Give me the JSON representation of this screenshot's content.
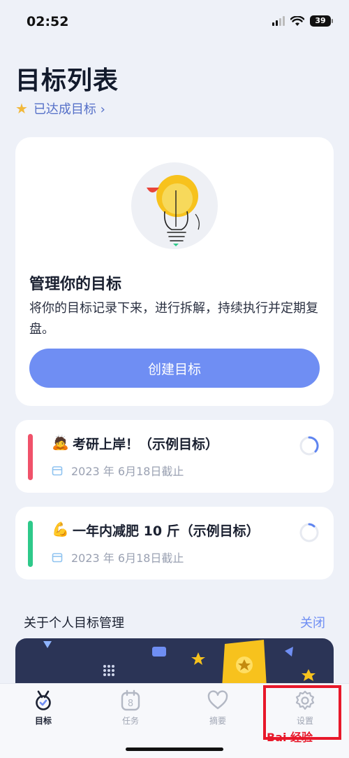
{
  "status": {
    "time": "02:52",
    "battery": "39"
  },
  "header": {
    "title": "目标列表",
    "achieved_link": "已达成目标 ›"
  },
  "hero": {
    "title": "管理你的目标",
    "description": "将你的目标记录下来，进行拆解，持续执行并定期复盘。",
    "create_button": "创建目标"
  },
  "goals": [
    {
      "emoji": "🙇",
      "title": "考研上岸！（示例目标）",
      "deadline": "2023 年 6月18日截止",
      "color": "#f0526a"
    },
    {
      "emoji": "💪",
      "title": "一年内减肥 10 斤（示例目标）",
      "deadline": "2023 年 6月18日截止",
      "color": "#2ec98a"
    }
  ],
  "about": {
    "title": "关于个人目标管理",
    "close_label": "关闭"
  },
  "tabs": [
    {
      "label": "目标",
      "icon": "medal-icon",
      "active": true
    },
    {
      "label": "任务",
      "icon": "calendar-8-icon",
      "active": false
    },
    {
      "label": "摘要",
      "icon": "heart-icon",
      "active": false
    },
    {
      "label": "设置",
      "icon": "gear-icon",
      "active": false
    }
  ],
  "watermark": "Bai 经验"
}
